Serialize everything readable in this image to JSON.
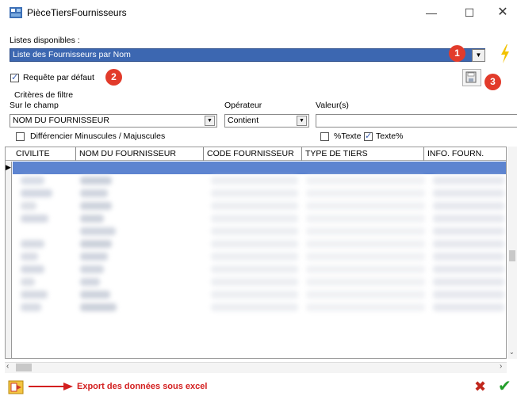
{
  "window": {
    "title": "PièceTiersFournisseurs"
  },
  "lists": {
    "label": "Listes disponibles :",
    "selected": "Liste des Fournisseurs par Nom"
  },
  "default_query": {
    "label": "Requête par défaut",
    "checked": true
  },
  "badges": [
    "1",
    "2",
    "3"
  ],
  "filters": {
    "title": "Critères de filtre",
    "field_label": "Sur le champ",
    "field_value": "NOM DU FOURNISSEUR",
    "operator_label": "Opérateur",
    "operator_value": "Contient",
    "value_label": "Valeur(s)",
    "value": "",
    "case_label": "Différencier Minuscules / Majuscules",
    "prefix_wildcard_label": "%Texte",
    "suffix_wildcard_label": "Texte%",
    "suffix_wildcard_checked": true
  },
  "grid": {
    "columns": [
      "CIVILITE",
      "NOM DU FOURNISSEUR",
      "CODE FOURNISSEUR",
      "TYPE DE TIERS",
      "INFO. FOURN."
    ]
  },
  "footer": {
    "export_label": "Export des données sous excel"
  },
  "colors": {
    "accent": "#3c67b1",
    "badge": "#e23b2b",
    "export_text": "#d31f1f",
    "ok": "#229e2a",
    "cancel": "#c0271d"
  }
}
